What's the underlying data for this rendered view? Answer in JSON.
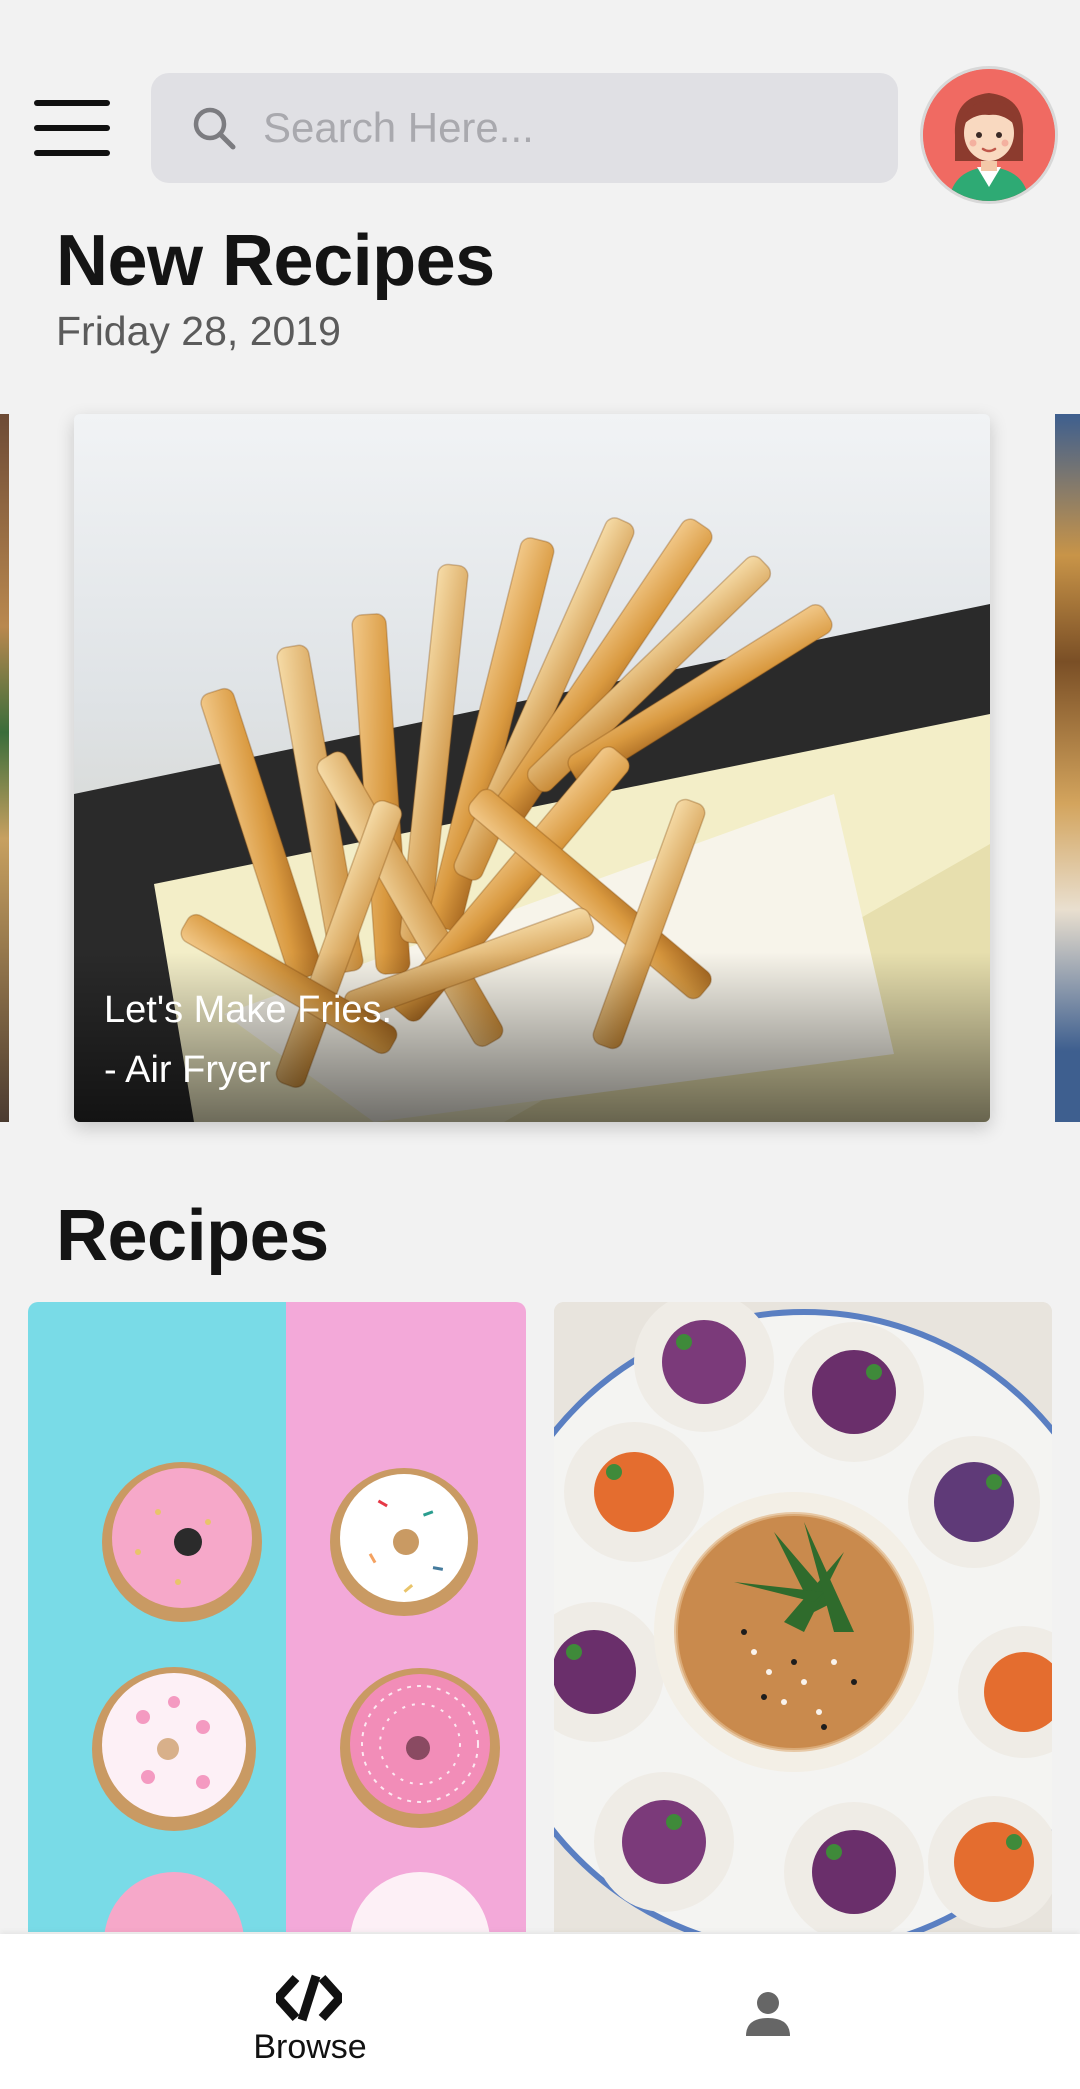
{
  "header": {
    "search_placeholder": "Search Here...",
    "menu_icon": "hamburger-menu-icon",
    "search_icon": "search-icon",
    "avatar_icon": "user-avatar"
  },
  "new_recipes": {
    "title": "New Recipes",
    "date": "Friday 28, 2019",
    "featured": {
      "caption_line1": "Let's Make Fries.",
      "caption_line2": "- Air Fryer"
    }
  },
  "recipes": {
    "title": "Recipes"
  },
  "bottom_nav": {
    "items": [
      {
        "label": "Browse",
        "icon": "browse-logo-icon",
        "active": true
      },
      {
        "label": "",
        "icon": "profile-icon",
        "active": false
      }
    ]
  },
  "colors": {
    "background": "#f2f2f2",
    "search_bg": "#e0e0e4",
    "text_primary": "#141414",
    "text_secondary": "#5b5b5b",
    "avatar_bg": "#f06a62"
  }
}
